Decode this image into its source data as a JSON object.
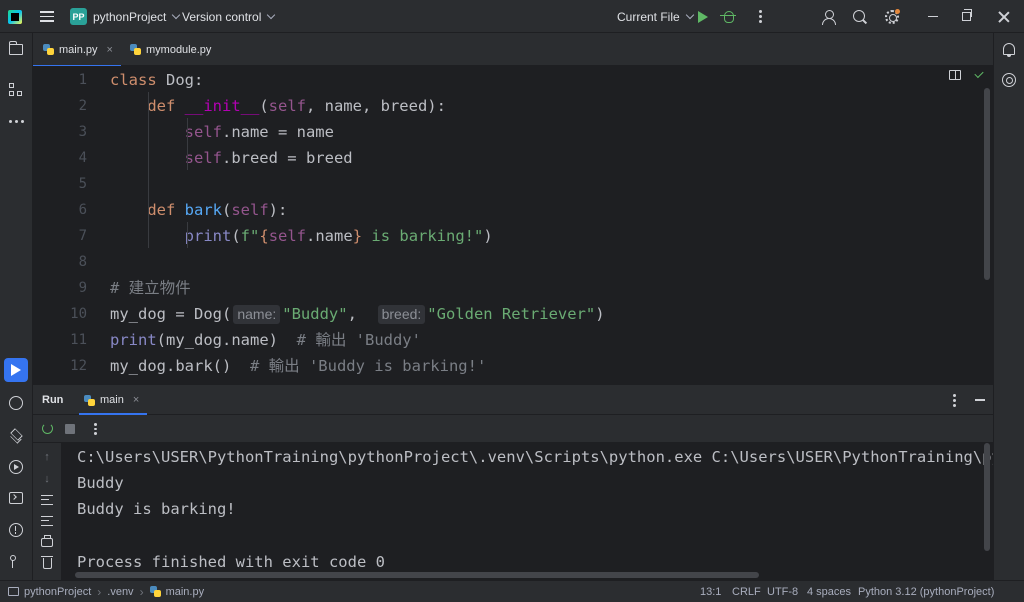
{
  "titlebar": {
    "project_badge": "PP",
    "project_name": "pythonProject",
    "version_control": "Version control",
    "run_config": "Current File",
    "icons": [
      "app-logo-icon",
      "menu-icon",
      "run-icon",
      "debug-icon",
      "more-icon",
      "code-with-me-icon",
      "search-icon",
      "settings-icon",
      "minimize-icon",
      "restore-icon",
      "close-icon"
    ]
  },
  "left_tools": [
    "project-folder-icon",
    "structure-icon",
    "more-icon",
    "run-tool-icon",
    "python-console-icon",
    "python-packages-icon",
    "services-icon",
    "terminal-icon",
    "problems-icon",
    "git-icon"
  ],
  "right_tools": [
    "notifications-icon",
    "ai-assistant-icon"
  ],
  "editor_tabs": [
    {
      "label": "main.py",
      "active": true,
      "close": "×"
    },
    {
      "label": "mymodule.py",
      "active": false
    }
  ],
  "editor": {
    "line_numbers": [
      "1",
      "2",
      "3",
      "4",
      "5",
      "6",
      "7",
      "8",
      "9",
      "10",
      "11",
      "12"
    ],
    "lines": [
      [
        {
          "t": "class ",
          "c": "kw"
        },
        {
          "t": "Dog:",
          "c": ""
        }
      ],
      [
        {
          "t": "    ",
          "c": ""
        },
        {
          "t": "def ",
          "c": "kw"
        },
        {
          "t": "__init__",
          "c": "magic"
        },
        {
          "t": "(",
          "c": ""
        },
        {
          "t": "self",
          "c": "selfc"
        },
        {
          "t": ", name, breed):",
          "c": ""
        }
      ],
      [
        {
          "t": "        ",
          "c": ""
        },
        {
          "t": "self",
          "c": "selfc"
        },
        {
          "t": ".name = name",
          "c": ""
        }
      ],
      [
        {
          "t": "        ",
          "c": ""
        },
        {
          "t": "self",
          "c": "selfc"
        },
        {
          "t": ".breed = breed",
          "c": ""
        }
      ],
      [],
      [
        {
          "t": "    ",
          "c": ""
        },
        {
          "t": "def ",
          "c": "kw"
        },
        {
          "t": "bark",
          "c": "fn"
        },
        {
          "t": "(",
          "c": ""
        },
        {
          "t": "self",
          "c": "selfc"
        },
        {
          "t": "):",
          "c": ""
        }
      ],
      [
        {
          "t": "        ",
          "c": ""
        },
        {
          "t": "print",
          "c": "bi"
        },
        {
          "t": "(",
          "c": ""
        },
        {
          "t": "f\"",
          "c": "str"
        },
        {
          "t": "{",
          "c": "kw"
        },
        {
          "t": "self",
          "c": "selfc"
        },
        {
          "t": ".name",
          "c": ""
        },
        {
          "t": "}",
          "c": "kw"
        },
        {
          "t": " is barking!\"",
          "c": "str"
        },
        {
          "t": ")",
          "c": ""
        }
      ],
      [],
      [
        {
          "t": "# 建立物件",
          "c": "cmt"
        }
      ],
      [
        {
          "t": "my_dog = Dog(",
          "c": ""
        },
        {
          "t": "name:",
          "c": "hint"
        },
        {
          "t": "\"Buddy\"",
          "c": "str"
        },
        {
          "t": ",  ",
          "c": ""
        },
        {
          "t": "breed:",
          "c": "hint"
        },
        {
          "t": "\"Golden Retriever\"",
          "c": "str"
        },
        {
          "t": ")",
          "c": ""
        }
      ],
      [
        {
          "t": "print",
          "c": "bi"
        },
        {
          "t": "(my_dog.name)  ",
          "c": ""
        },
        {
          "t": "# 輸出 'Buddy'",
          "c": "cmt"
        }
      ],
      [
        {
          "t": "my_dog.bark()  ",
          "c": ""
        },
        {
          "t": "# 輸出 'Buddy is barking!'",
          "c": "cmt"
        }
      ]
    ]
  },
  "run_panel": {
    "title": "Run",
    "tab_label": "main",
    "tab_close": "×",
    "output": [
      "C:\\Users\\USER\\PythonTraining\\pythonProject\\.venv\\Scripts\\python.exe C:\\Users\\USER\\PythonTraining\\pythonProject\\main.py",
      "Buddy",
      "Buddy is barking!",
      "",
      "Process finished with exit code 0"
    ]
  },
  "statusbar": {
    "breadcrumb": [
      "pythonProject",
      ".venv",
      "main.py"
    ],
    "separator": "›",
    "position": "13:1",
    "line_ending": "CRLF",
    "encoding": "UTF-8",
    "indent": "4 spaces",
    "interpreter": "Python 3.12 (pythonProject)"
  },
  "colors": {
    "accent": "#3574f0",
    "run_green": "#5fb865",
    "background": "#1e1f22",
    "panel": "#2b2d30"
  }
}
